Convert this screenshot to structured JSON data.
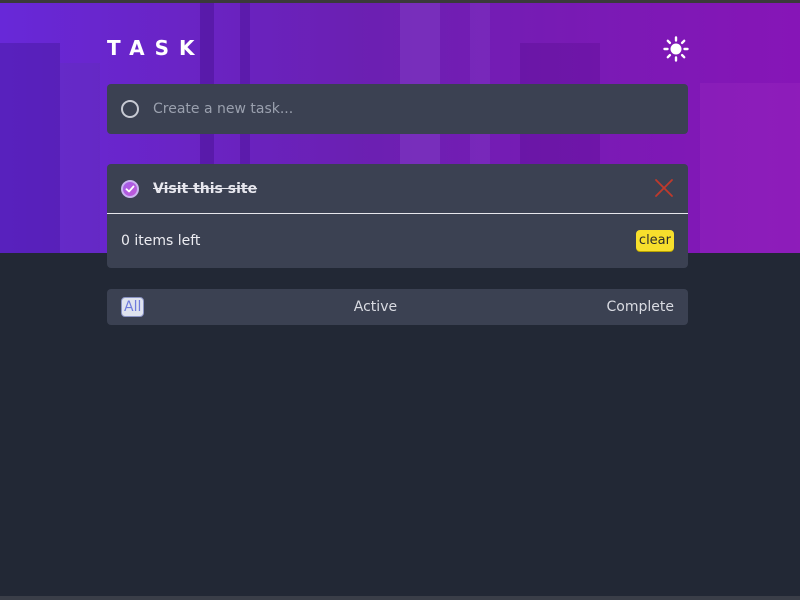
{
  "app": {
    "title": "TASK"
  },
  "icons": {
    "theme_toggle": "sun-icon",
    "new_task_circle": "circle-icon",
    "completed": "check-circle-icon",
    "delete": "cross-icon"
  },
  "colors": {
    "accent": "#a35ee8",
    "clear_button": "#f7df2c",
    "delete_icon": "#c0392b",
    "background": "#222835",
    "card": "#3b4152"
  },
  "new_task": {
    "placeholder": "Create a new task..."
  },
  "tasks": [
    {
      "text": "Visit this site",
      "completed": true
    }
  ],
  "footer": {
    "items_left": "0 items left",
    "clear_label": "clear"
  },
  "filters": {
    "all": "All",
    "active": "Active",
    "complete": "Complete",
    "selected": "All"
  }
}
